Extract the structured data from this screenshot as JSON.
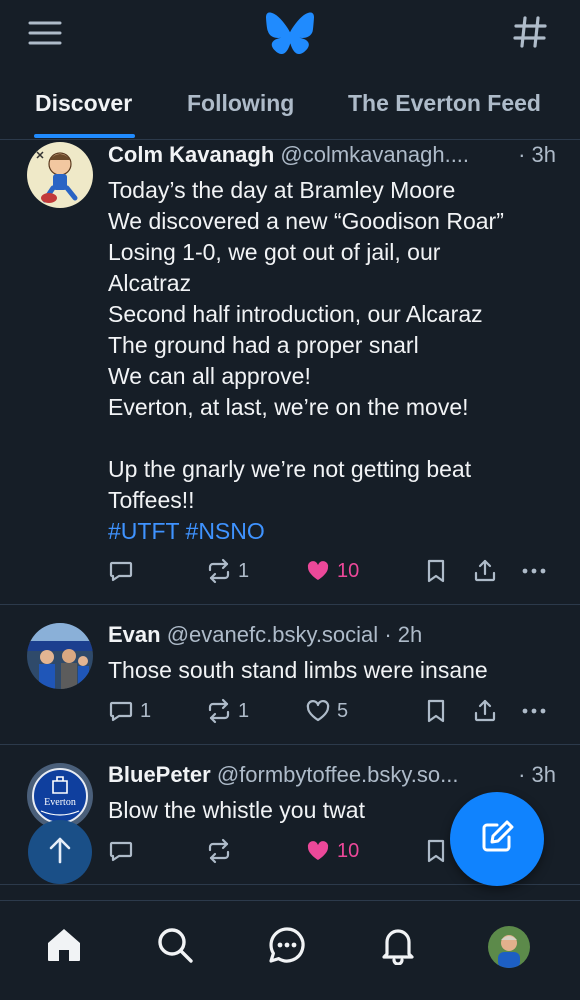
{
  "colors": {
    "background": "#161e27",
    "accent": "#208bfe",
    "like": "#ec4899",
    "muted": "#aebbc9",
    "hashtag": "#3f93ff"
  },
  "header": {
    "menu_icon": "hamburger-menu-icon",
    "logo": "butterfly-logo",
    "feeds_icon": "hashtag-icon"
  },
  "tabs": [
    {
      "label": "Discover",
      "active": true
    },
    {
      "label": "Following",
      "active": false
    },
    {
      "label": "The Everton Feed",
      "active": false
    }
  ],
  "posts": [
    {
      "author": "Colm Kavanagh",
      "handle": "@colmkavanagh....",
      "time": "· 3h",
      "lines": [
        "Today’s the day at Bramley Moore",
        "We discovered a new “Goodison Roar”",
        "Losing 1-0, we got out of jail, our",
        "Alcatraz",
        "Second half introduction, our Alcaraz",
        "The ground had a proper snarl",
        "We can all approve!",
        "Everton, at last, we’re on the move!",
        "",
        "Up the gnarly we’re not getting beat",
        "Toffees!!"
      ],
      "hashtags": "#UTFT #NSNO",
      "replies": "",
      "reposts": "1",
      "likes": "10",
      "liked": true
    },
    {
      "author": "Evan",
      "handle": "@evanefc.bsky.social",
      "time": "· 2h",
      "lines": [
        "Those south stand limbs were insane"
      ],
      "replies": "1",
      "reposts": "1",
      "likes": "5",
      "liked": false
    },
    {
      "author": "BluePeter",
      "handle": "@formbytoffee.bsky.so...",
      "time": "· 3h",
      "lines": [
        "Blow the whistle you twat"
      ],
      "replies": "",
      "reposts": "",
      "likes": "10",
      "liked": true,
      "avatar_text": "Everton"
    }
  ],
  "floating": {
    "scroll_top_icon": "arrow-up-icon",
    "compose_icon": "compose-icon"
  },
  "bottom_nav": [
    "home-icon",
    "search-icon",
    "chat-icon",
    "bell-icon",
    "profile-avatar"
  ]
}
